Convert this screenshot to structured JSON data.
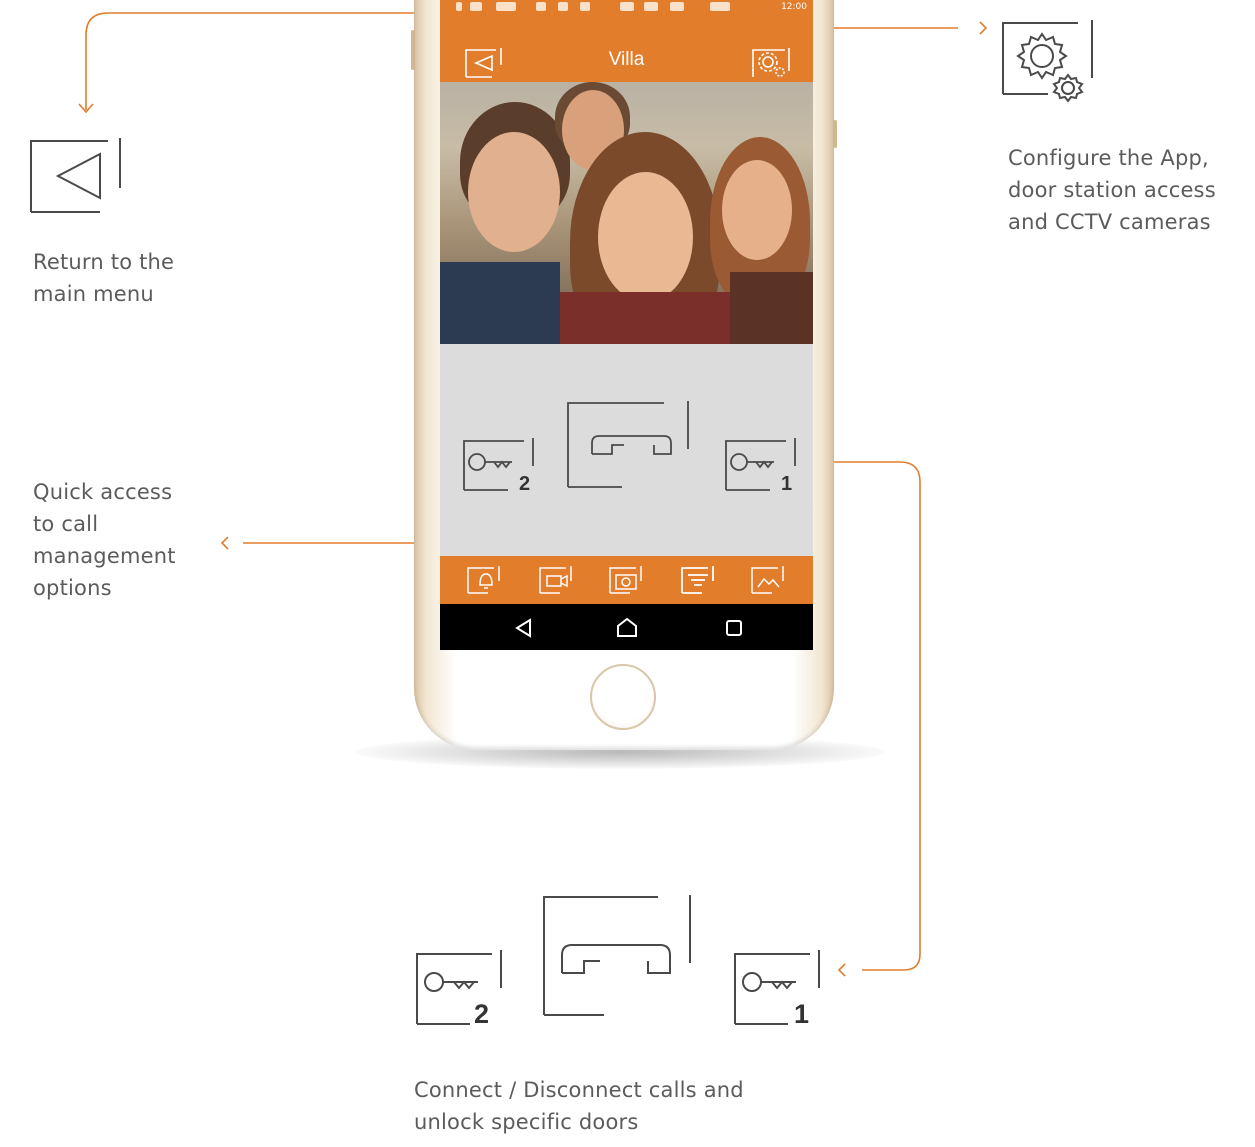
{
  "callouts": {
    "return_text": "Return to the\nmain menu",
    "configure_text": "Configure the App,\ndoor station access\nand CCTV cameras",
    "quick_text": "Quick access\nto call\nmanagement\noptions",
    "connect_text": "Connect / Disconnect calls and\nunlock specific doors"
  },
  "app": {
    "title": "Villa",
    "status_time": "12:00"
  },
  "doors": {
    "left_number": "2",
    "right_number": "1"
  },
  "icons": {
    "back": "back-arrow-icon",
    "settings": "gears-icon",
    "key": "key-icon",
    "handset": "handset-icon",
    "toolbar": [
      "door-bell-icon",
      "video-camera-icon",
      "camera-snapshot-icon",
      "volume-bars-icon",
      "gallery-icon"
    ],
    "nav": [
      "nav-back-icon",
      "nav-home-icon",
      "nav-recents-icon"
    ]
  },
  "colors": {
    "accent": "#e27d2c",
    "text": "#5b5b5b",
    "icon_stroke": "#4a4a4a",
    "screen_bg": "#dcdcdc"
  }
}
